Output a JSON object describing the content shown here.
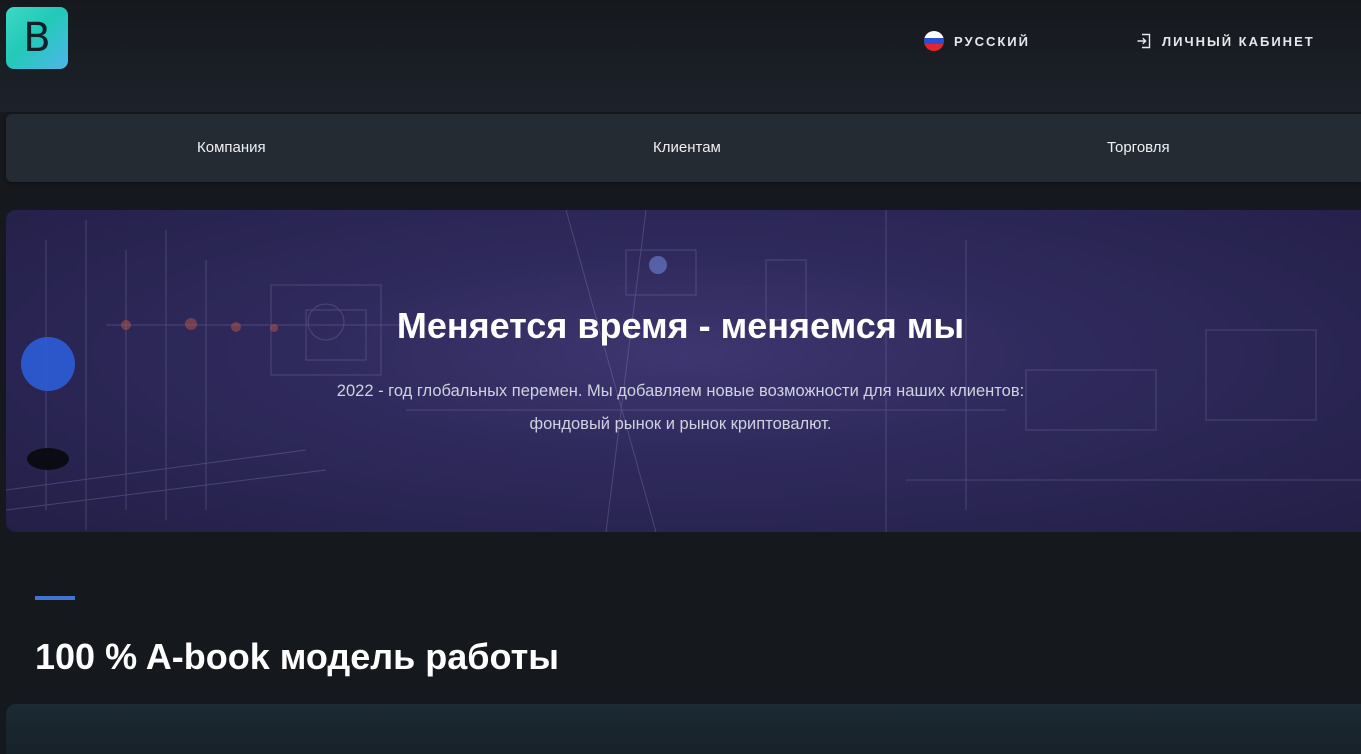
{
  "header": {
    "logo_letter": "B",
    "language_label": "РУССКИЙ",
    "cabinet_label": "ЛИЧНЫЙ КАБИНЕТ"
  },
  "nav": {
    "items": [
      {
        "label": "Компания"
      },
      {
        "label": "Клиентам"
      },
      {
        "label": "Торговля"
      }
    ]
  },
  "hero": {
    "title": "Меняется время - меняемся мы",
    "subtitle": "2022 - год глобальных перемен. Мы добавляем новые возможности для наших клиентов: фондовый рынок и рынок криптовалют."
  },
  "section": {
    "title": "100 % A-book модель работы"
  },
  "colors": {
    "background": "#15191e",
    "nav_background": "#252b33",
    "accent": "#3f73d4",
    "logo_gradient_start": "#3fd8c4",
    "logo_gradient_end": "#4fb6ea",
    "hero_tint": "#2f2a5c"
  },
  "icons": {
    "language": "russian-flag-icon",
    "cabinet": "login-icon"
  }
}
